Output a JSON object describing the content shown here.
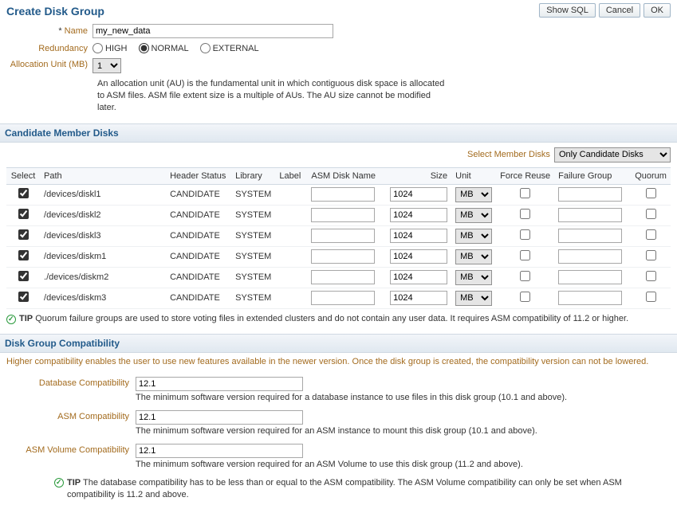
{
  "title": "Create Disk Group",
  "buttons": {
    "show_sql": "Show SQL",
    "cancel": "Cancel",
    "ok": "OK"
  },
  "form": {
    "name_label": "Name",
    "name_value": "my_new_data",
    "redundancy_label": "Redundancy",
    "redundancy_options": {
      "high": "HIGH",
      "normal": "NORMAL",
      "external": "EXTERNAL"
    },
    "au_label": "Allocation Unit (MB)",
    "au_value": "1",
    "au_help": "An allocation unit (AU) is the fundamental unit in which contiguous disk space is allocated to ASM files. ASM file extent size is a multiple of AUs. The AU size cannot be modified later."
  },
  "candidate": {
    "section_title": "Candidate Member Disks",
    "select_disks_label": "Select Member Disks",
    "select_disks_value": "Only Candidate Disks",
    "columns": {
      "select": "Select",
      "path": "Path",
      "header_status": "Header Status",
      "library": "Library",
      "label": "Label",
      "asm_disk_name": "ASM Disk Name",
      "size": "Size",
      "unit": "Unit",
      "force_reuse": "Force Reuse",
      "failure_group": "Failure Group",
      "quorum": "Quorum"
    },
    "unit_option": "MB",
    "rows": [
      {
        "path": "/devices/diskl1",
        "header_status": "CANDIDATE",
        "library": "SYSTEM",
        "asm_disk_name": "",
        "size": "1024",
        "failure_group": ""
      },
      {
        "path": "/devices/diskl2",
        "header_status": "CANDIDATE",
        "library": "SYSTEM",
        "asm_disk_name": "",
        "size": "1024",
        "failure_group": ""
      },
      {
        "path": "/devices/diskl3",
        "header_status": "CANDIDATE",
        "library": "SYSTEM",
        "asm_disk_name": "",
        "size": "1024",
        "failure_group": ""
      },
      {
        "path": "/devices/diskm1",
        "header_status": "CANDIDATE",
        "library": "SYSTEM",
        "asm_disk_name": "",
        "size": "1024",
        "failure_group": ""
      },
      {
        "path": "./devices/diskm2",
        "header_status": "CANDIDATE",
        "library": "SYSTEM",
        "asm_disk_name": "",
        "size": "1024",
        "failure_group": ""
      },
      {
        "path": "/devices/diskm3",
        "header_status": "CANDIDATE",
        "library": "SYSTEM",
        "asm_disk_name": "",
        "size": "1024",
        "failure_group": ""
      }
    ],
    "tip_label": "TIP",
    "tip_text": "Quorum failure groups are used to store voting files in extended clusters and do not contain any user data. It requires ASM compatibility of 11.2 or higher."
  },
  "compat": {
    "section_title": "Disk Group Compatibility",
    "intro": "Higher compatibility enables the user to use new features available in the newer version. Once the disk group is created, the compatibility version can not be lowered.",
    "db_label": "Database Compatibility",
    "db_value": "12.1",
    "db_note": "The minimum software version required for a database instance to use files in this disk group (10.1 and above).",
    "asm_label": "ASM Compatibility",
    "asm_value": "12.1",
    "asm_note": "The minimum software version required for an ASM instance to mount this disk group (10.1 and above).",
    "vol_label": "ASM Volume Compatibility",
    "vol_value": "12.1",
    "vol_note": "The minimum software version required for an ASM Volume to use this disk group (11.2 and above).",
    "tip_label": "TIP",
    "tip_text": "The database compatibility has to be less than or equal to the ASM compatibility. The ASM Volume compatibility can only be set when ASM compatibility is 11.2 and above."
  }
}
